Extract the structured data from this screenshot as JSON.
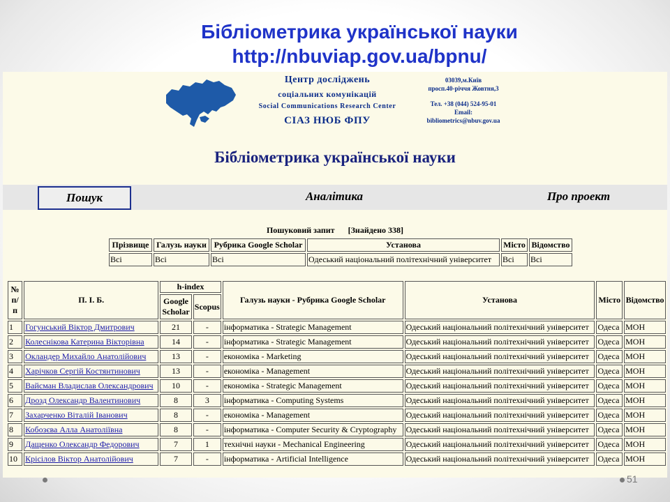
{
  "slide": {
    "title_line1": "Бібліометрика української науки",
    "title_line2": "http://nbuviap.gov.ua/bpnu/",
    "page_number": "51"
  },
  "header": {
    "org_line1": "Центр досліджень",
    "org_line2": "соціальних комунікацій",
    "org_line3": "Social Communications Research Center",
    "org_line4": "СІАЗ НЮБ ФПУ",
    "addr_line1": "03039,м.Київ",
    "addr_line2": "просп.40-річчя Жовтня,3",
    "addr_line3": "Тел. +38 (044) 524-95-01",
    "addr_line4": "Email:",
    "addr_line5": "bibliometrics@nbuv.gov.ua",
    "site_title": "Бібліометрика української науки",
    "map_color": "#1e5aa8"
  },
  "nav": {
    "search": "Пошук",
    "analytics": "Аналітика",
    "about": "Про проект"
  },
  "query": {
    "caption": "Пошуковий запит",
    "found": "[Знайдено 338]",
    "headers": [
      "Прізвище",
      "Галузь науки",
      "Рубрика Google Scholar",
      "Установа",
      "Місто",
      "Відомство"
    ],
    "values": [
      "Всі",
      "Всі",
      "Всі",
      "Одеський національний політехнічний університет",
      "Всі",
      "Всі"
    ]
  },
  "results": {
    "headers": {
      "num": "№ п/п",
      "name": "П. І. Б.",
      "hindex": "h-index",
      "google": "Google Scholar",
      "scopus": "Scopus",
      "field": "Галузь науки - Рубрика Google Scholar",
      "inst": "Установа",
      "city": "Місто",
      "dept": "Відомство"
    },
    "rows": [
      {
        "n": "1",
        "name": "Гогунський Віктор Дмитрович",
        "g": "21",
        "s": "-",
        "field": "інформатика - Strategic Management",
        "inst": "Одеський національний політехнічний університет",
        "city": "Одеса",
        "dept": "МОН"
      },
      {
        "n": "2",
        "name": "Колеснікова Катерина Вікторівна",
        "g": "14",
        "s": "-",
        "field": "інформатика - Strategic Management",
        "inst": "Одеський національний політехнічний університет",
        "city": "Одеса",
        "dept": "МОН"
      },
      {
        "n": "3",
        "name": "Окландер Михайло Анатолійович",
        "g": "13",
        "s": "-",
        "field": "економіка - Marketing",
        "inst": "Одеський національний політехнічний університет",
        "city": "Одеса",
        "dept": "МОН"
      },
      {
        "n": "4",
        "name": "Харічков Сергій Костянтинович",
        "g": "13",
        "s": "-",
        "field": "економіка - Management",
        "inst": "Одеський національний політехнічний університет",
        "city": "Одеса",
        "dept": "МОН"
      },
      {
        "n": "5",
        "name": "Вайсман Владислав Олександрович",
        "g": "10",
        "s": "-",
        "field": "економіка - Strategic Management",
        "inst": "Одеський національний політехнічний університет",
        "city": "Одеса",
        "dept": "МОН"
      },
      {
        "n": "6",
        "name": "Дрозд Олександр Валентинович",
        "g": "8",
        "s": "3",
        "field": "інформатика - Computing Systems",
        "inst": "Одеський національний політехнічний університет",
        "city": "Одеса",
        "dept": "МОН"
      },
      {
        "n": "7",
        "name": "Захарченко Віталій Іванович",
        "g": "8",
        "s": "-",
        "field": "економіка - Management",
        "inst": "Одеський національний політехнічний університет",
        "city": "Одеса",
        "dept": "МОН"
      },
      {
        "n": "8",
        "name": "Кобозєва Алла Анатоліївна",
        "g": "8",
        "s": "-",
        "field": "інформатика - Computer Security & Cryptography",
        "inst": "Одеський національний політехнічний університет",
        "city": "Одеса",
        "dept": "МОН"
      },
      {
        "n": "9",
        "name": "Дащенко Олександр Федорович",
        "g": "7",
        "s": "1",
        "field": "технічні науки - Mechanical Engineering",
        "inst": "Одеський національний політехнічний університет",
        "city": "Одеса",
        "dept": "МОН"
      },
      {
        "n": "10",
        "name": "Крісілов Віктор Анатолійович",
        "g": "7",
        "s": "-",
        "field": "інформатика - Artificial Intelligence",
        "inst": "Одеський національний політехнічний університет",
        "city": "Одеса",
        "dept": "МОН"
      }
    ]
  }
}
